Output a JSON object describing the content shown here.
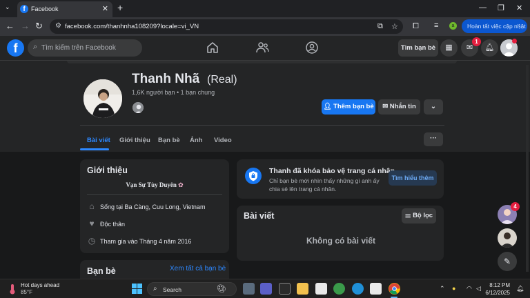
{
  "browser": {
    "tab_title": "Facebook",
    "url": "facebook.com/thanhnha108209?locale=vi_VN",
    "update_label": "Hoàn tất việc cập nhật",
    "profile_initial": "a"
  },
  "fb_header": {
    "search_placeholder": "Tìm kiếm trên Facebook",
    "find_friends": "Tìm bạn bè",
    "messenger_badge": "1"
  },
  "profile": {
    "name": "Thanh Nhã",
    "nickname": "(Real)",
    "friends_line": "1,6K người bạn • 1 bạn chung",
    "add_friend": "Thêm bạn bè",
    "message": "Nhắn tin",
    "tabs": [
      "Bài viết",
      "Giới thiệu",
      "Bạn bè",
      "Ảnh",
      "Video"
    ],
    "more": "···"
  },
  "intro": {
    "title": "Giới thiệu",
    "bio": "Vạn Sự Tùy Duyên",
    "rows": [
      {
        "icon": "home-icon",
        "text": "Sống tại Ba Càng, Cuu Long, Vietnam"
      },
      {
        "icon": "heart-icon",
        "text": "Độc thân"
      },
      {
        "icon": "clock-icon",
        "text": "Tham gia vào Tháng 4 năm 2016"
      }
    ]
  },
  "lock_notice": {
    "title": "Thanh đã khóa bảo vệ trang cá nhân",
    "desc": "Chỉ bạn bè mới nhìn thấy những gì anh ấy chia sẻ lên trang cá nhân.",
    "button": "Tìm hiểu thêm"
  },
  "posts": {
    "title": "Bài viết",
    "filter": "Bộ lọc",
    "empty": "Không có bài viết"
  },
  "friends_card": {
    "title": "Bạn bè",
    "see_all": "Xem tất cả bạn bè"
  },
  "float": {
    "chat_badge": "4"
  },
  "taskbar": {
    "weather_title": "Hot days ahead",
    "weather_temp": "85°F",
    "search": "Search",
    "time": "8:12 PM",
    "date": "6/12/2025"
  },
  "colors": {
    "accent": "#1877f2",
    "link": "#2d88ff",
    "background": "#18191a",
    "card": "#242526"
  }
}
